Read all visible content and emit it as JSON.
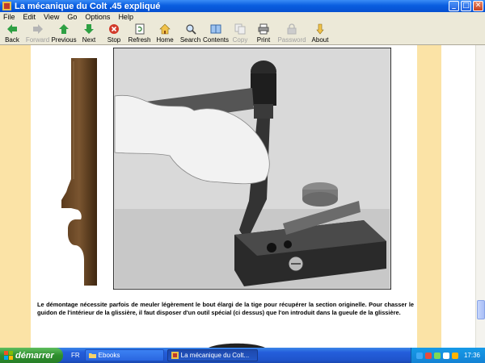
{
  "window": {
    "title": "La mécanique du Colt .45 expliqué",
    "minimize": "_",
    "maximize": "□",
    "close": "✕"
  },
  "menu": [
    "File",
    "Edit",
    "View",
    "Go",
    "Options",
    "Help"
  ],
  "toolbar": [
    {
      "label": "Back",
      "icon": "arrow-left-icon",
      "enabled": true
    },
    {
      "label": "Forward",
      "icon": "arrow-right-icon",
      "enabled": false
    },
    {
      "label": "Previous",
      "icon": "arrow-up-icon",
      "enabled": true
    },
    {
      "label": "Next",
      "icon": "arrow-down-icon",
      "enabled": true
    },
    {
      "label": "Stop",
      "icon": "stop-icon",
      "enabled": true
    },
    {
      "label": "Refresh",
      "icon": "refresh-icon",
      "enabled": true
    },
    {
      "label": "Home",
      "icon": "home-icon",
      "enabled": true
    },
    {
      "label": "Search",
      "icon": "search-icon",
      "enabled": true
    },
    {
      "label": "Contents",
      "icon": "contents-icon",
      "enabled": true
    },
    {
      "label": "Copy",
      "icon": "copy-icon",
      "enabled": false
    },
    {
      "label": "Print",
      "icon": "print-icon",
      "enabled": true
    },
    {
      "label": "Password",
      "icon": "password-icon",
      "enabled": false
    },
    {
      "label": "About",
      "icon": "about-icon",
      "enabled": true
    }
  ],
  "page": {
    "caption": "Le démontage nécessite parfois de meuler légèrement le bout élargi de la tige pour récupérer la section originelle. Pour chasser le guidon de l'intérieur de la glissière, il faut disposer d'un outil spécial (ci dessus) que l'on introduit dans la gueule de la glissière."
  },
  "taskbar": {
    "start": "démarrer",
    "lang": "FR",
    "items": [
      {
        "label": "Ebooks",
        "active": false
      },
      {
        "label": "La mécanique du Colt...",
        "active": true
      }
    ],
    "clock": "17:36"
  },
  "colors": {
    "page_stripe": "#fbe3a6",
    "titlebar": "#0a5ee0",
    "taskbar": "#245edb"
  }
}
